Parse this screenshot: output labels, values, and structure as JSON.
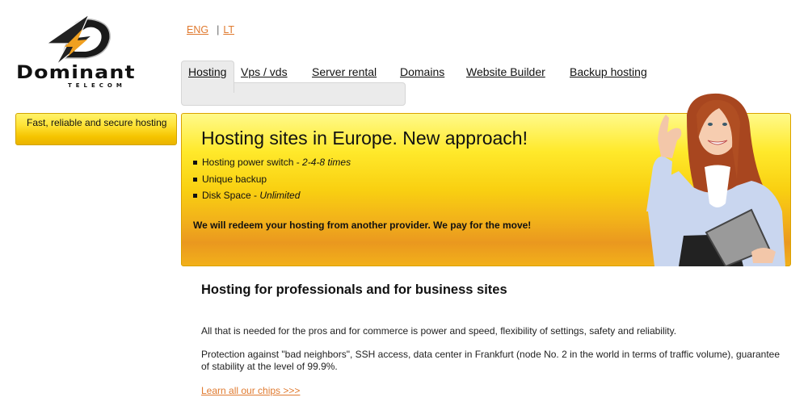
{
  "brand": {
    "name": "Dominant",
    "subtitle": "TELECOM"
  },
  "languages": {
    "items": [
      "ENG",
      "LT"
    ],
    "separator": "|",
    "active": "ENG"
  },
  "nav": {
    "active": "Hosting",
    "items": [
      {
        "label": "Hosting"
      },
      {
        "label": "Vps / vds"
      },
      {
        "label": "Server rental"
      },
      {
        "label": "Domains"
      },
      {
        "label": "Website Builder"
      },
      {
        "label": "Backup hosting"
      }
    ]
  },
  "sidebar": {
    "box_label": "Fast, reliable and secure hosting"
  },
  "banner": {
    "title": "Hosting sites in Europe. New approach!",
    "features": [
      {
        "label": "Hosting power switch - ",
        "value": "2-4-8 times"
      },
      {
        "label": "Unique backup",
        "value": ""
      },
      {
        "label": "Disk Space - ",
        "value": "Unlimited"
      }
    ],
    "promo": "We will redeem your hosting from another provider. We pay for the move!",
    "image_alt": "smiling woman holding a tablet making an OK gesture"
  },
  "content": {
    "heading": "Hosting for professionals and for business sites",
    "paragraph1": "All that is needed for the pros and for commerce is power and speed, flexibility of settings, safety and reliability.",
    "paragraph2": "Protection against \"bad neighbors\", SSH access, data center in Frankfurt (node No. 2 in the world in terms of traffic volume), guarantee of stability at the level of 99.9%.",
    "more_link": "Learn all our chips >>>"
  },
  "colors": {
    "link_accent": "#e07a2f",
    "banner_top": "#fffa8a",
    "banner_bottom": "#ea981f",
    "logo_bolt": "#f0a020"
  }
}
